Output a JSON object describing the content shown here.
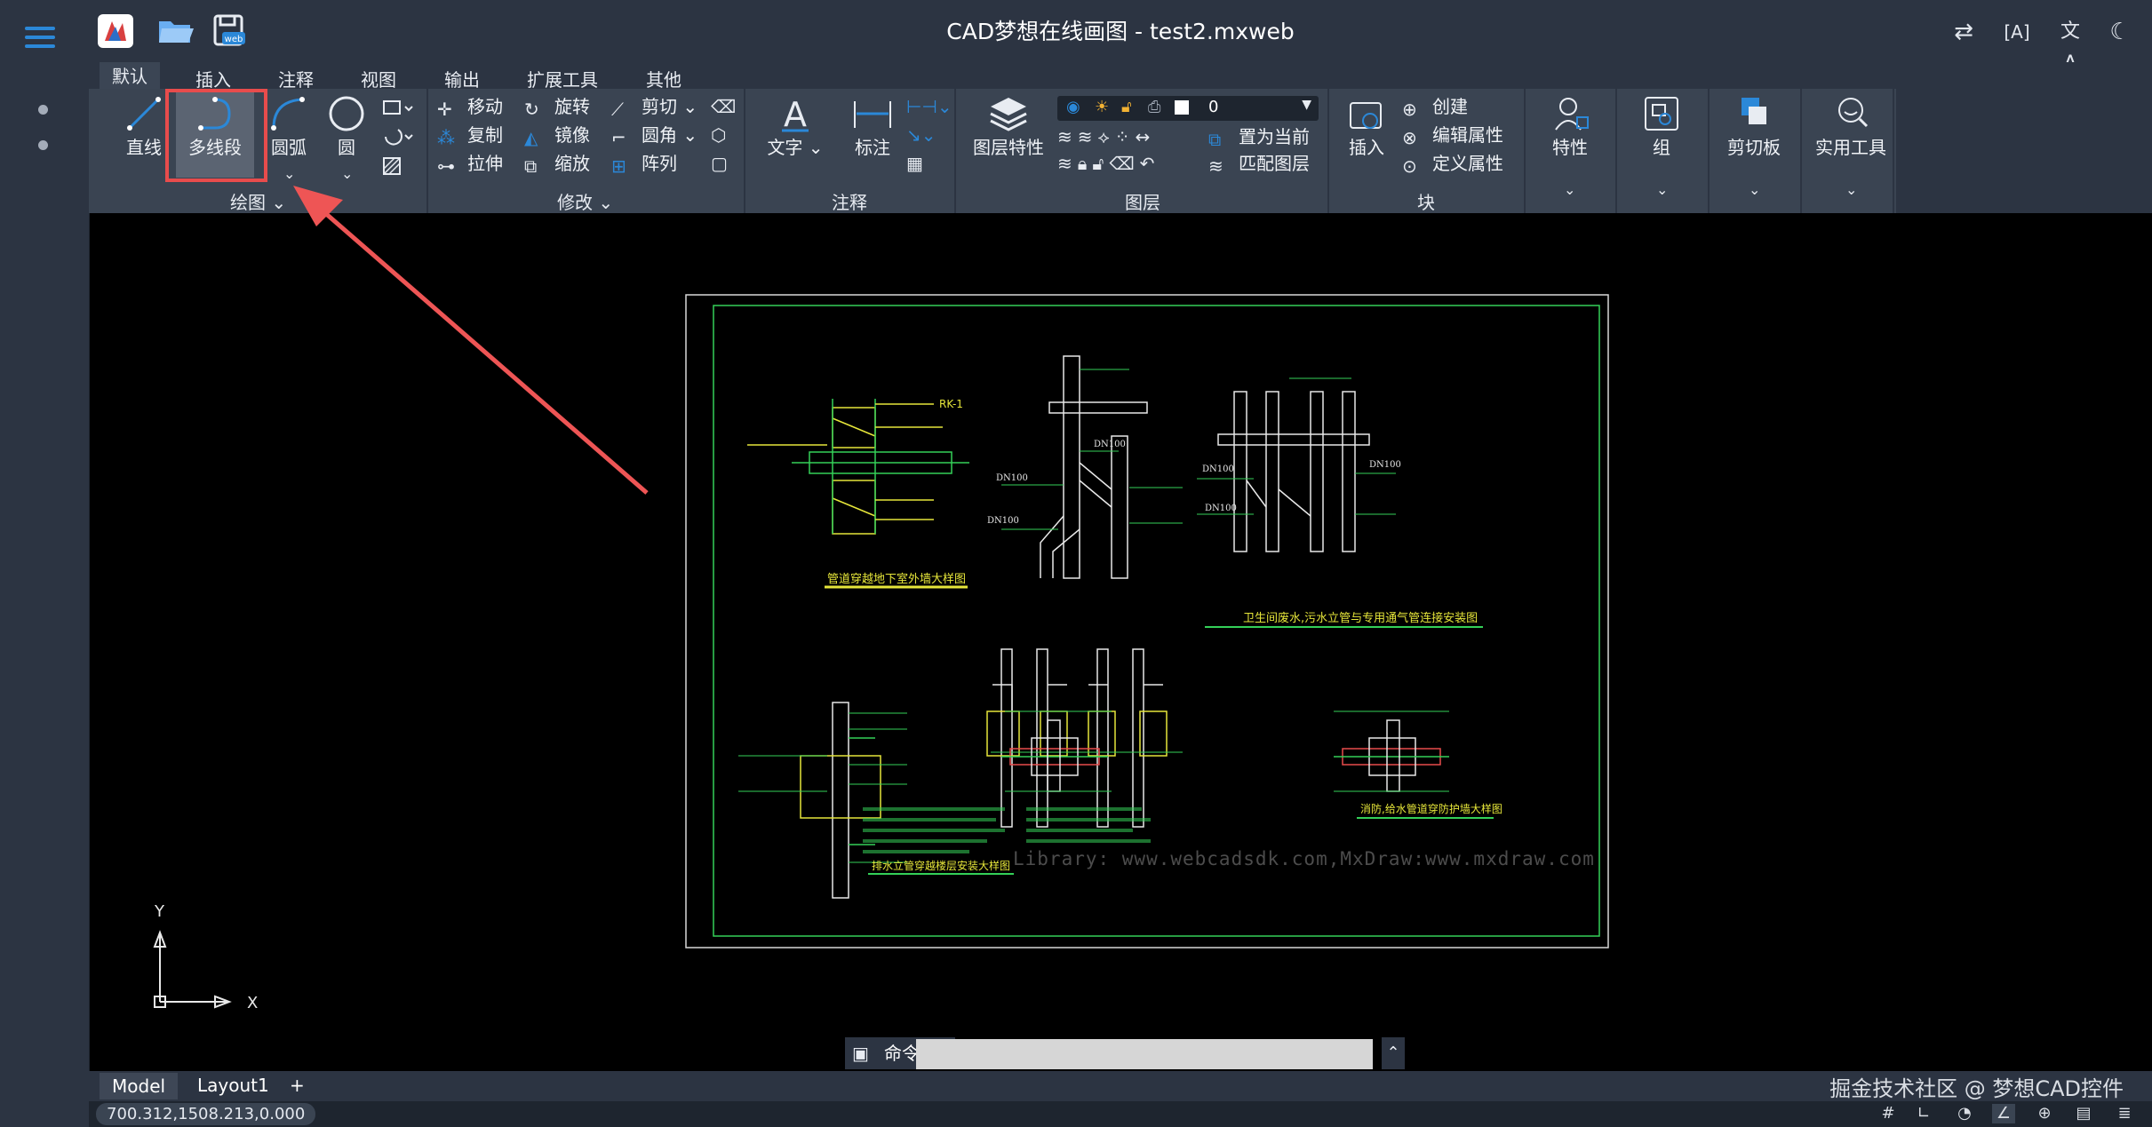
{
  "window": {
    "title": "CAD梦想在线画图 - test2.mxweb"
  },
  "ribbon_tabs": [
    "默认",
    "插入",
    "注释",
    "视图",
    "输出",
    "扩展工具",
    "其他"
  ],
  "draw_group": {
    "label": "绘图",
    "line": "直线",
    "polyline": "多线段",
    "arc": "圆弧",
    "circle": "圆"
  },
  "modify_group": {
    "label": "修改",
    "move": "移动",
    "rotate": "旋转",
    "trim": "剪切",
    "copy": "复制",
    "mirror": "镜像",
    "fillet": "圆角",
    "stretch": "拉伸",
    "scale": "缩放",
    "array": "阵列"
  },
  "annotation_group": {
    "label": "注释",
    "text": "文字",
    "dimension": "标注"
  },
  "layer_group": {
    "label": "图层",
    "properties": "图层特性",
    "current_layer": "0",
    "set_current": "置为当前",
    "match_layer": "匹配图层"
  },
  "block_group": {
    "label": "块",
    "insert": "插入",
    "create": "创建",
    "edit_attr": "编辑属性",
    "define_attr": "定义属性"
  },
  "extra_groups": {
    "properties": "特性",
    "group": "组",
    "clipboard": "剪切板",
    "utilities": "实用工具"
  },
  "drawing": {
    "watermark": "Library: www.webcadsdk.com,MxDraw:www.mxdraw.com",
    "captions": [
      "管道穿越地下室外墙大样图",
      "卫生间废水,污水立管与专用通气管连接安装图",
      "排水立管穿越楼层安装大样图",
      "消防,给水管道穿防护墙大样图"
    ],
    "labels": {
      "label_1": "RK-1",
      "label_2": "DN100",
      "label_3": "DN100",
      "label_4": "DN100",
      "label_5": "DN100",
      "label_6": "DN100",
      "label_7": "DN100"
    }
  },
  "ucs": {
    "x": "X",
    "y": "Y"
  },
  "command": {
    "label": "命令:",
    "value": ""
  },
  "layout_tabs": {
    "model": "Model",
    "layout1": "Layout1",
    "add": "+"
  },
  "status": {
    "coords": "700.312,1508.213,0.000",
    "credit": "掘金技术社区 @ 梦想CAD控件"
  },
  "colors": {
    "accent": "#2b88d8",
    "highlight": "#e84c4c",
    "cad_green": "#34d058",
    "cad_yellow": "#e6e63a"
  }
}
